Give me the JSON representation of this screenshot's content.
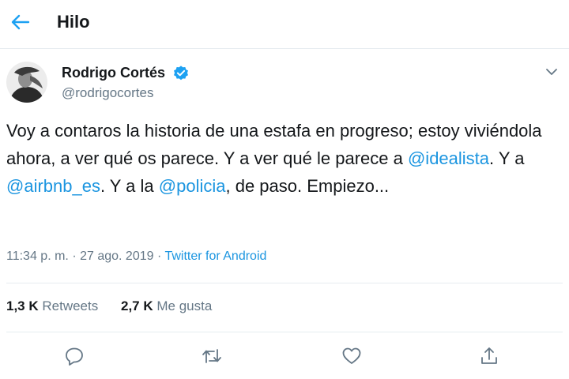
{
  "header": {
    "title": "Hilo",
    "back_icon": "arrow-left-icon"
  },
  "tweet": {
    "author": {
      "name": "Rodrigo Cortés",
      "handle": "@rodrigocortes",
      "verified": true
    },
    "text": {
      "p1": "Voy a contaros la historia de una estafa en progreso; estoy viviéndola ahora, a ver qué os parece. Y a ver qué le parece a ",
      "mention1": "@idealista",
      "p2": ". Y a ",
      "mention2": "@airbnb_es",
      "p3": ". Y a la ",
      "mention3": "@policia",
      "p4": ", de paso. Empiezo..."
    },
    "time": "11:34 p. m.",
    "separator": "·",
    "date": "27 ago. 2019",
    "source": "Twitter for Android"
  },
  "stats": {
    "retweets_count": "1,3 K",
    "retweets_label": "Retweets",
    "likes_count": "2,7 K",
    "likes_label": "Me gusta"
  },
  "actions": {
    "reply_icon": "reply-icon",
    "retweet_icon": "retweet-icon",
    "like_icon": "heart-icon",
    "share_icon": "share-icon"
  },
  "colors": {
    "accent": "#1da1f2",
    "link": "#1b95e0",
    "secondary_text": "#657786",
    "border": "#e6ecf0"
  }
}
